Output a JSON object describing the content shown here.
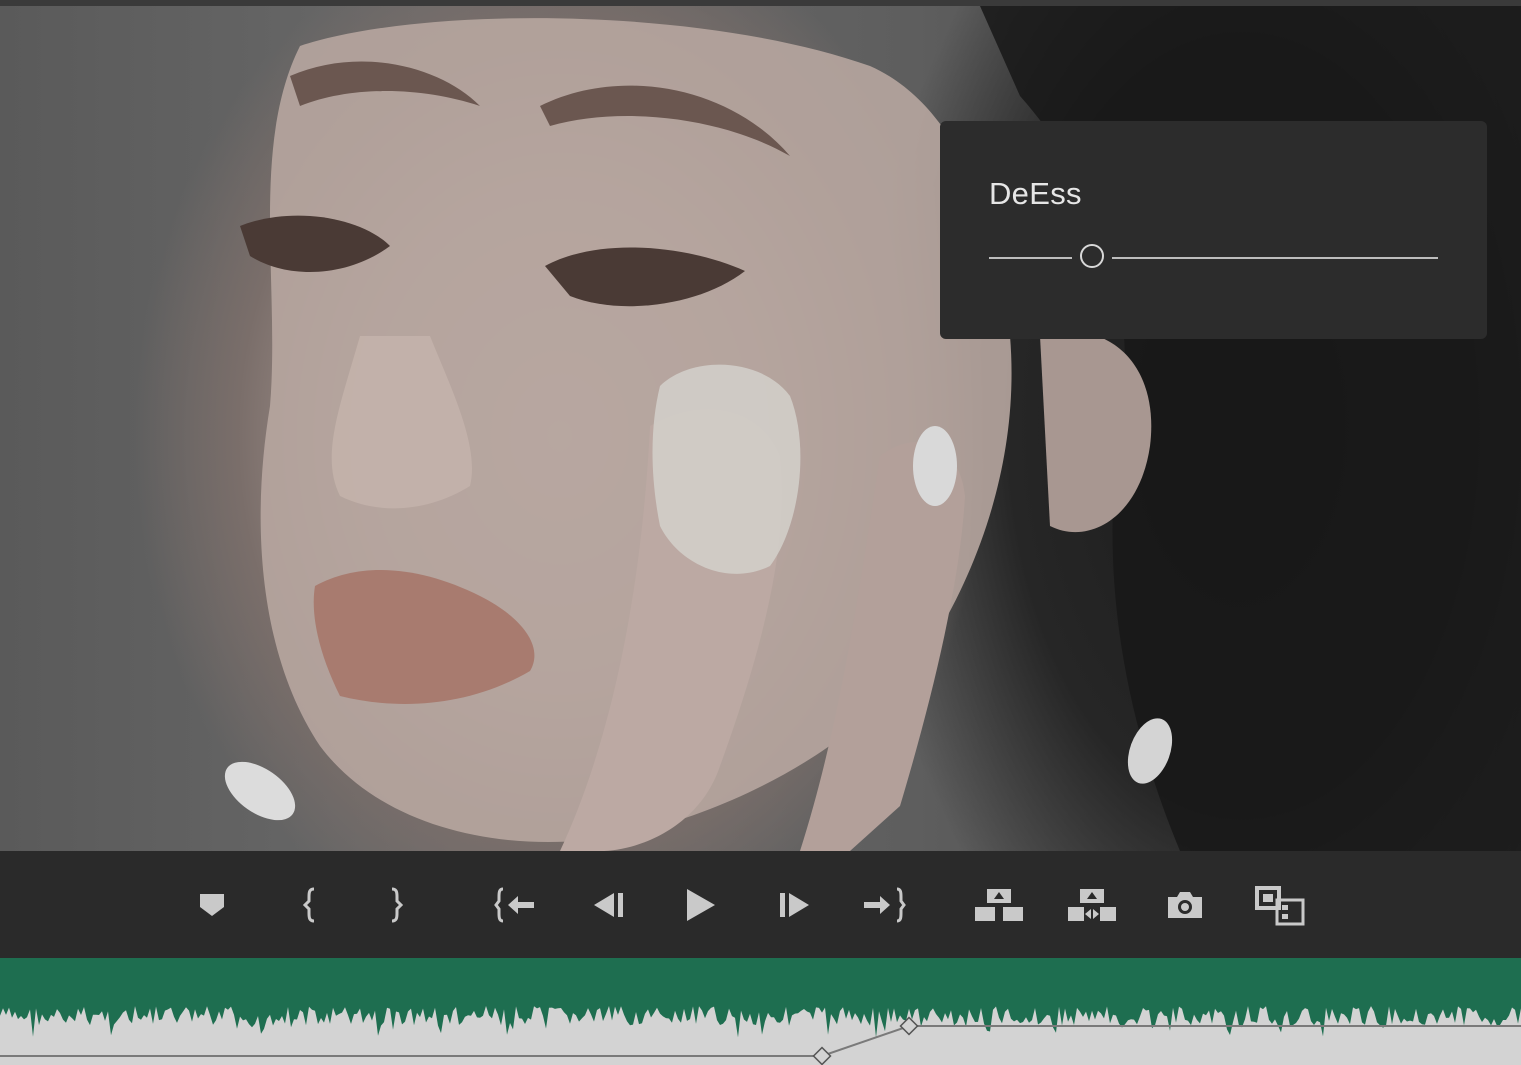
{
  "effect_panel": {
    "title": "DeEss",
    "slider_value_fraction": 0.23
  },
  "toolbar": {
    "buttons": [
      {
        "name": "add-marker-button",
        "icon": "marker-icon"
      },
      {
        "name": "mark-in-button",
        "icon": "mark-in-icon"
      },
      {
        "name": "mark-out-button",
        "icon": "mark-out-icon"
      },
      {
        "name": "go-to-in-button",
        "icon": "go-to-in-icon"
      },
      {
        "name": "step-back-button",
        "icon": "step-back-icon"
      },
      {
        "name": "play-button",
        "icon": "play-icon"
      },
      {
        "name": "step-forward-button",
        "icon": "step-forward-icon"
      },
      {
        "name": "go-to-out-button",
        "icon": "go-to-out-icon"
      },
      {
        "name": "lift-button",
        "icon": "lift-icon"
      },
      {
        "name": "extract-button",
        "icon": "extract-icon"
      },
      {
        "name": "export-frame-button",
        "icon": "camera-icon"
      },
      {
        "name": "comparison-view-button",
        "icon": "compare-icon"
      }
    ]
  },
  "colors": {
    "background": "#2b2b2b",
    "panel": "#2c2c2c",
    "waveform": "#1e6e50",
    "waveform_background": "#d3d3d3",
    "icon": "#c9c9c9"
  }
}
